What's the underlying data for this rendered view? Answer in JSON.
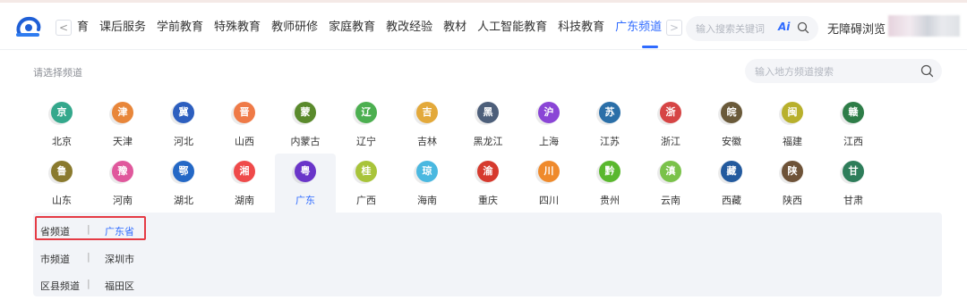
{
  "topbar": {
    "nav_prev": "<",
    "nav_next": ">",
    "nav_items": [
      {
        "label": "育"
      },
      {
        "label": "课后服务"
      },
      {
        "label": "学前教育"
      },
      {
        "label": "特殊教育"
      },
      {
        "label": "教师研修"
      },
      {
        "label": "家庭教育"
      },
      {
        "label": "教改经验"
      },
      {
        "label": "教材"
      },
      {
        "label": "人工智能教育"
      },
      {
        "label": "科技教育"
      },
      {
        "label": "广东频道",
        "active": true
      }
    ],
    "caret": "^",
    "search_placeholder": "输入搜索关键词",
    "ai_label": "Ai",
    "accessibility": "无障碍浏览"
  },
  "channel_picker": {
    "prompt": "请选择频道",
    "search_placeholder": "输入地方频道搜索"
  },
  "provinces": [
    [
      {
        "abbr": "京",
        "name": "北京",
        "color": "#34a88c"
      },
      {
        "abbr": "津",
        "name": "天津",
        "color": "#e8863a"
      },
      {
        "abbr": "冀",
        "name": "河北",
        "color": "#2d5fbf"
      },
      {
        "abbr": "晋",
        "name": "山西",
        "color": "#ef7a47"
      },
      {
        "abbr": "蒙",
        "name": "内蒙古",
        "color": "#5a8a2c"
      },
      {
        "abbr": "辽",
        "name": "辽宁",
        "color": "#4caf50"
      },
      {
        "abbr": "吉",
        "name": "吉林",
        "color": "#e3a93b"
      },
      {
        "abbr": "黑",
        "name": "黑龙江",
        "color": "#4d5f7a"
      },
      {
        "abbr": "沪",
        "name": "上海",
        "color": "#8a45d6"
      },
      {
        "abbr": "苏",
        "name": "江苏",
        "color": "#2b6fa8"
      },
      {
        "abbr": "浙",
        "name": "浙江",
        "color": "#d64545"
      },
      {
        "abbr": "皖",
        "name": "安徽",
        "color": "#6a5a3a"
      },
      {
        "abbr": "闽",
        "name": "福建",
        "color": "#b8b02c"
      },
      {
        "abbr": "赣",
        "name": "江西",
        "color": "#2e7d48"
      }
    ],
    [
      {
        "abbr": "鲁",
        "name": "山东",
        "color": "#8a7a2e"
      },
      {
        "abbr": "豫",
        "name": "河南",
        "color": "#e0589c"
      },
      {
        "abbr": "鄂",
        "name": "湖北",
        "color": "#2468c6"
      },
      {
        "abbr": "湘",
        "name": "湖南",
        "color": "#ef4a4a"
      },
      {
        "abbr": "粤",
        "name": "广东",
        "color": "#6a35c9",
        "active": true
      },
      {
        "abbr": "桂",
        "name": "广西",
        "color": "#a8c43a"
      },
      {
        "abbr": "琼",
        "name": "海南",
        "color": "#4ab8e0"
      },
      {
        "abbr": "渝",
        "name": "重庆",
        "color": "#d63a2e"
      },
      {
        "abbr": "川",
        "name": "四川",
        "color": "#ef8a2c"
      },
      {
        "abbr": "黔",
        "name": "贵州",
        "color": "#5ab82e"
      },
      {
        "abbr": "滇",
        "name": "云南",
        "color": "#7ac24a"
      },
      {
        "abbr": "藏",
        "name": "西藏",
        "color": "#235a9e"
      },
      {
        "abbr": "陕",
        "name": "陕西",
        "color": "#6e5338"
      },
      {
        "abbr": "甘",
        "name": "甘肃",
        "color": "#2e7d5a"
      }
    ]
  ],
  "levels": [
    {
      "label": "省频道",
      "sep": "|",
      "value": "广东省"
    },
    {
      "label": "市频道",
      "sep": "|",
      "value": "深圳市"
    },
    {
      "label": "区县频道",
      "sep": "|",
      "value": "福田区"
    }
  ],
  "colors": {
    "accent": "#2f6bff",
    "highlight_border": "#e53b45"
  }
}
